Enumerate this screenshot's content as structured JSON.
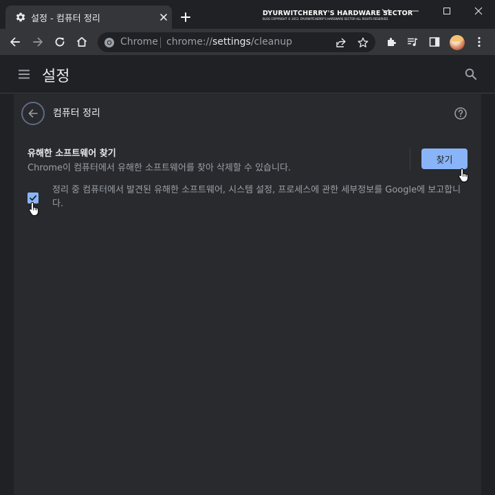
{
  "tab": {
    "title": "설정 - 컴퓨터 정리",
    "icon": "gear-icon"
  },
  "watermark": {
    "main": "DYURWITCHERRY'S HARDWARE SECTOR",
    "sub": "BLOG COPYRIGHT © 2013. DYURWITCHERRY'S HARDWARE SECTOR ALL RIGHTS RESERVED."
  },
  "omnibox": {
    "chip_label": "Chrome",
    "url_scheme": "chrome://",
    "url_host": "settings",
    "url_path": "/cleanup"
  },
  "header": {
    "title": "설정"
  },
  "page": {
    "title": "컴퓨터 정리",
    "find_title": "유해한 소프트웨어 찾기",
    "find_desc": "Chrome이 컴퓨터에서 유해한 소프트웨어를 찾아 삭제할 수 있습니다.",
    "find_button": "찾기",
    "report_label": "정리 중 컴퓨터에서 발견된 유해한 소프트웨어, 시스템 설정, 프로세스에 관한 세부정보를 Google에 보고합니다.",
    "report_checked": true
  },
  "colors": {
    "accent": "#8ab4f8",
    "background": "#202124",
    "card": "#292a2d",
    "toolbar": "#35363a"
  }
}
